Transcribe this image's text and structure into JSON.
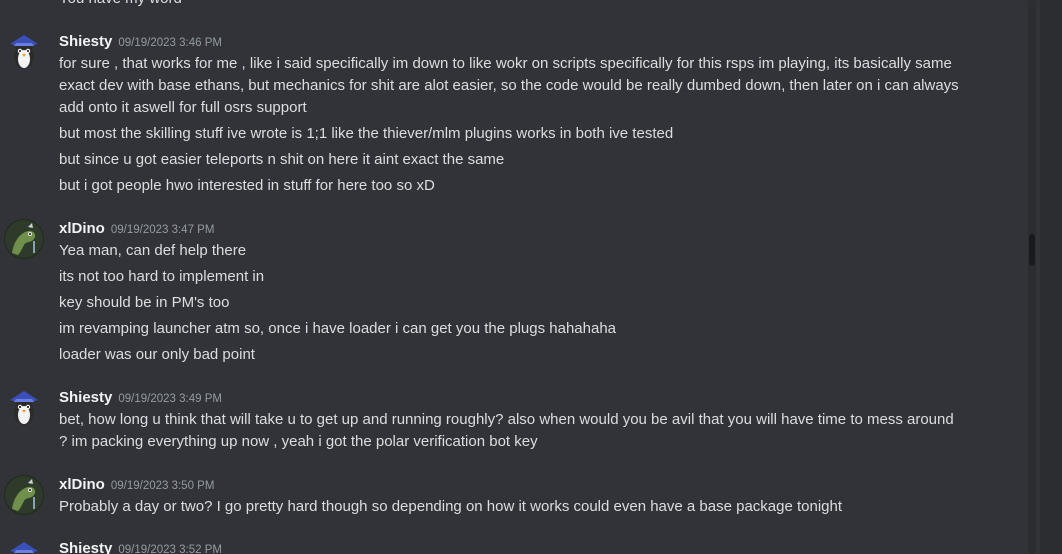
{
  "top_partial": "You have my word",
  "messages": [
    {
      "author": "Shiesty",
      "timestamp": "09/19/2023 3:46 PM",
      "avatar_icon": "penguin-avatar",
      "lines": [
        "for sure , that works for me , like i said specifically im down to like wokr on scripts specifically for this rsps im playing, its basically same",
        "exact dev with base ethans, but mechanics for shit are alot easier, so the code would be really dumbed down, then later on i can always",
        "add onto it aswell for full osrs support",
        "but most the skilling stuff ive wrote is 1;1 like the thiever/mlm plugins works in both ive tested",
        "but since u got easier teleports n shit on here it aint exact the same",
        "but i got people hwo interested in stuff for here too so xD"
      ]
    },
    {
      "author": "xlDino",
      "timestamp": "09/19/2023 3:47 PM",
      "avatar_icon": "dino-avatar",
      "lines": [
        "Yea man, can def help there",
        "its not too hard to implement in",
        "key should be in PM's too",
        "im revamping launcher atm so, once i have loader i can get you the plugs hahahaha",
        "loader was our only bad point"
      ]
    },
    {
      "author": "Shiesty",
      "timestamp": "09/19/2023 3:49 PM",
      "avatar_icon": "penguin-avatar",
      "lines": [
        "bet, how long u think that will take u to get up and running roughly? also when would you be avil that you will have time to mess around",
        "? im packing everything up now , yeah i got the polar verification bot key"
      ]
    },
    {
      "author": "xlDino",
      "timestamp": "09/19/2023 3:50 PM",
      "avatar_icon": "dino-avatar",
      "lines": [
        "Probably a day or two? I go pretty hard though so depending on how it works could even have a base package tonight"
      ]
    },
    {
      "author": "Shiesty",
      "timestamp": "09/19/2023 3:52 PM",
      "avatar_icon": "penguin-avatar",
      "lines": []
    }
  ],
  "colors": {
    "background": "#313338",
    "text": "#dbdee1",
    "author": "#f2f3f5",
    "timestamp": "#949ba4"
  }
}
